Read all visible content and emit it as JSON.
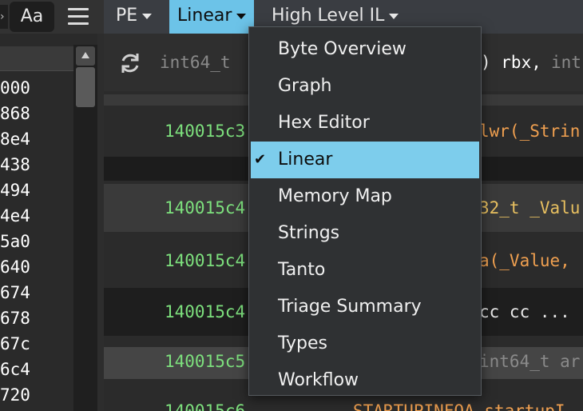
{
  "sidebar": {
    "aa_label": "Aa",
    "caret_glyph": "›",
    "addresses": [
      "000",
      "868",
      "8e4",
      "438",
      "494",
      "4e4",
      "5a0",
      "640",
      "674",
      "678",
      "67c",
      "6c4",
      "720"
    ]
  },
  "tabs": {
    "pe": "PE",
    "linear": "Linear",
    "hlil": "High Level IL"
  },
  "toolbar": {
    "type_text": "int64_t",
    "rbx_text": ") rbx,",
    "int_text": "int"
  },
  "rows": [
    {
      "addr": "140015c3",
      "text": "lwr(_Strin"
    },
    {
      "addr": "140015c4",
      "text": "32_t _Valu"
    },
    {
      "addr": "140015c4",
      "text": "a(_Value, "
    },
    {
      "addr": "140015c4",
      "text": "cc cc  ..."
    },
    {
      "addr": "140015c5",
      "text": "int64_t ar"
    },
    {
      "addr": "140015c6",
      "text": "STARTUPINFOA startupI"
    }
  ],
  "menu": {
    "items": [
      "Byte Overview",
      "Graph",
      "Hex Editor",
      "Linear",
      "Memory Map",
      "Strings",
      "Tanto",
      "Triage Summary",
      "Types",
      "Workflow"
    ],
    "selected": "Linear",
    "check_glyph": "✔"
  },
  "colors": {
    "accent": "#6cc3e8",
    "address_green": "#7de07d",
    "function_orange": "#f0a050",
    "type_yellow": "#e8c060"
  }
}
